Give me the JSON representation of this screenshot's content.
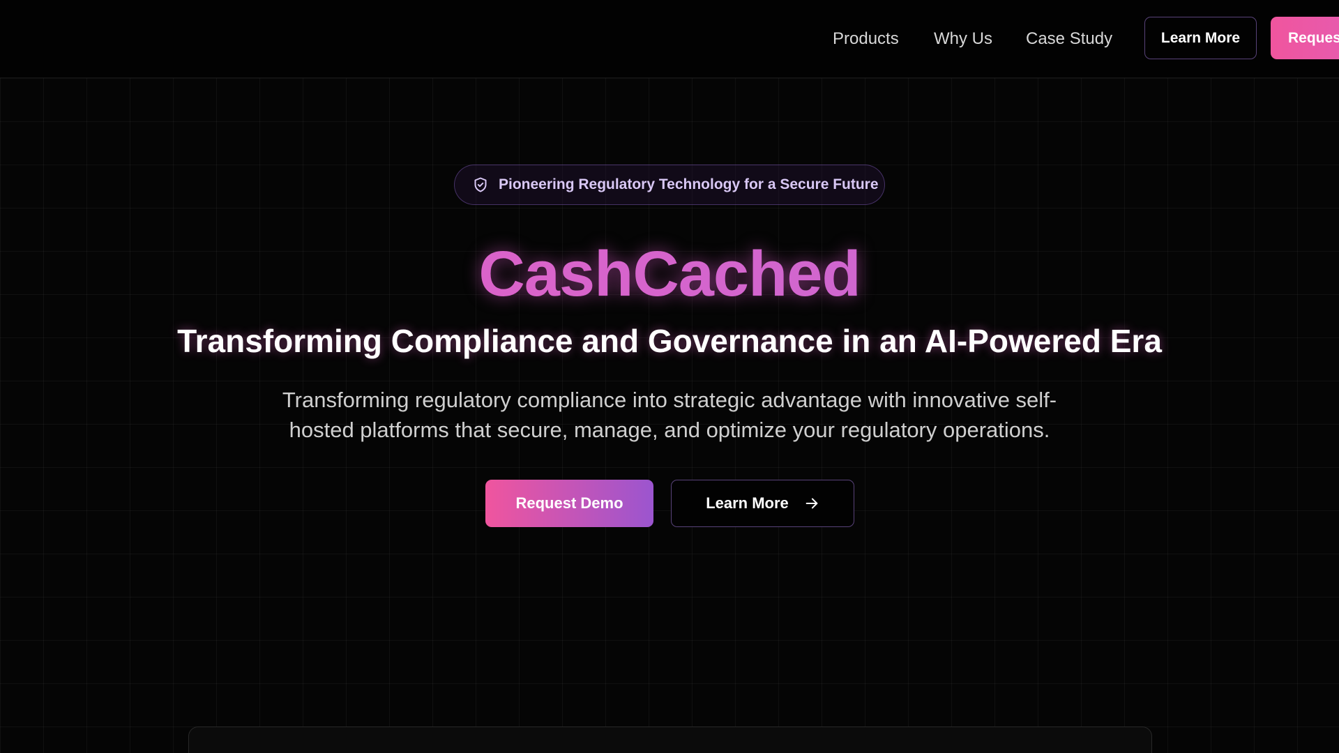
{
  "nav": {
    "links": [
      {
        "label": "Products"
      },
      {
        "label": "Why Us"
      },
      {
        "label": "Case Study"
      }
    ],
    "learn_more_label": "Learn More",
    "request_label": "Request Demo"
  },
  "hero": {
    "badge_icon": "shield-check-icon",
    "badge_text": "Pioneering Regulatory Technology for a Secure Future",
    "brand": "CashCached",
    "headline": "Transforming Compliance and Governance in an AI-Powered Era",
    "subtext": "Transforming regulatory compliance into strategic advantage with innovative self-hosted platforms that secure, manage, and optimize your regulatory operations.",
    "primary_cta": "Request Demo",
    "secondary_cta": "Learn More",
    "secondary_cta_icon": "arrow-right-icon"
  },
  "colors": {
    "background": "#050505",
    "accent_pink": "#f0559e",
    "accent_purple": "#9b55cf",
    "brand_gradient_start": "#e85fc3",
    "brand_gradient_end": "#c36ad6"
  }
}
